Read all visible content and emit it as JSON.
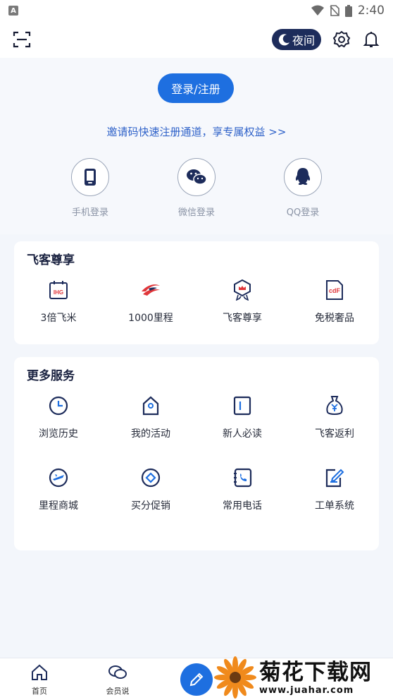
{
  "status_bar": {
    "time": "2:40",
    "left_icon": "A"
  },
  "top_bar": {
    "scan_icon": "scan-icon",
    "night_label": "夜间",
    "settings_icon": "gear-icon",
    "bell_icon": "bell-icon"
  },
  "header": {
    "login_label": "登录/注册",
    "invite_text": "邀请码快速注册通道，享专属权益 >>",
    "methods": [
      {
        "label": "手机登录",
        "icon": "phone-icon"
      },
      {
        "label": "微信登录",
        "icon": "wechat-icon"
      },
      {
        "label": "QQ登录",
        "icon": "qq-icon"
      }
    ]
  },
  "vip_card": {
    "title": "飞客尊享",
    "items": [
      {
        "label": "3倍飞米",
        "icon": "ihg-calendar-icon",
        "icon_text": "IHG"
      },
      {
        "label": "1000里程",
        "icon": "china-eastern-icon"
      },
      {
        "label": "飞客尊享",
        "icon": "crown-badge-icon"
      },
      {
        "label": "免税奢品",
        "icon": "cdf-icon",
        "icon_text": "cdF"
      }
    ]
  },
  "services_card": {
    "title": "更多服务",
    "items": [
      {
        "label": "浏览历史",
        "icon": "clock-icon"
      },
      {
        "label": "我的活动",
        "icon": "home-tag-icon"
      },
      {
        "label": "新人必读",
        "icon": "book-icon"
      },
      {
        "label": "飞客返利",
        "icon": "money-bag-icon"
      },
      {
        "label": "里程商城",
        "icon": "plane-circle-icon"
      },
      {
        "label": "买分促销",
        "icon": "diamond-circle-icon"
      },
      {
        "label": "常用电话",
        "icon": "phone-book-icon"
      },
      {
        "label": "工单系统",
        "icon": "edit-note-icon"
      }
    ]
  },
  "bottom_nav": {
    "items": [
      {
        "label": "首页",
        "icon": "home-icon"
      },
      {
        "label": "会员说",
        "icon": "chat-icon"
      }
    ],
    "fab_icon": "pen-icon"
  },
  "watermark": {
    "cn": "菊花下载网",
    "url": "www.juahar.com"
  },
  "colors": {
    "accent": "#1e6fe0",
    "night_bg": "#1d2c5b",
    "link": "#2f62c9",
    "icon_navy": "#1d2c5b",
    "icon_red": "#e0363a"
  }
}
